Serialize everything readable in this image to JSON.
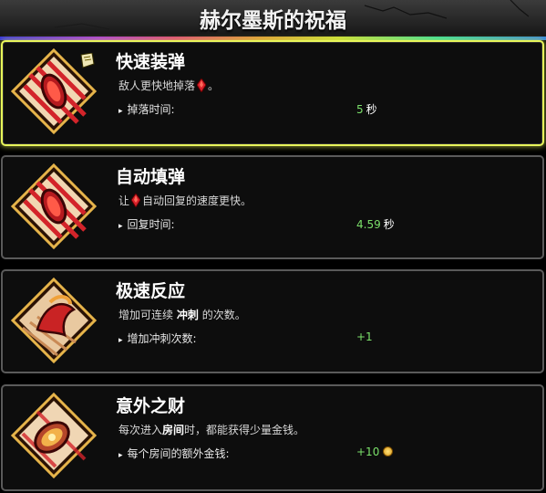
{
  "header": {
    "title": "赫尔墨斯的祝福"
  },
  "colors": {
    "selected_border": "#e8f55a",
    "card_border": "#5a5a5a",
    "stat_value": "#7be06a",
    "gem": "#d8202a"
  },
  "boons": [
    {
      "name": "快速装弹",
      "desc_pre": "敌人更快地掉落",
      "desc_icon": "bloodstone-icon",
      "desc_post": "。",
      "stat_label": "掉落时间:",
      "stat_value": "5",
      "stat_unit": "秒",
      "selected": true
    },
    {
      "name": "自动填弹",
      "desc_pre": "让",
      "desc_icon": "bloodstone-icon",
      "desc_post": "自动回复的速度更快。",
      "stat_label": "回复时间:",
      "stat_value": "4.59",
      "stat_unit": "秒",
      "selected": false
    },
    {
      "name": "极速反应",
      "desc_pre": "增加可连续",
      "desc_bold": "冲刺",
      "desc_post": "的次数。",
      "stat_label": "增加冲刺次数:",
      "stat_value": "+1",
      "selected": false
    },
    {
      "name": "意外之财",
      "desc_pre": "每次进入",
      "desc_bold": "房间",
      "desc_post": "时，都能获得少量金钱。",
      "stat_label": "每个房间的额外金钱:",
      "stat_value": "+10",
      "stat_icon": "obol-coin-icon",
      "selected": false
    }
  ]
}
